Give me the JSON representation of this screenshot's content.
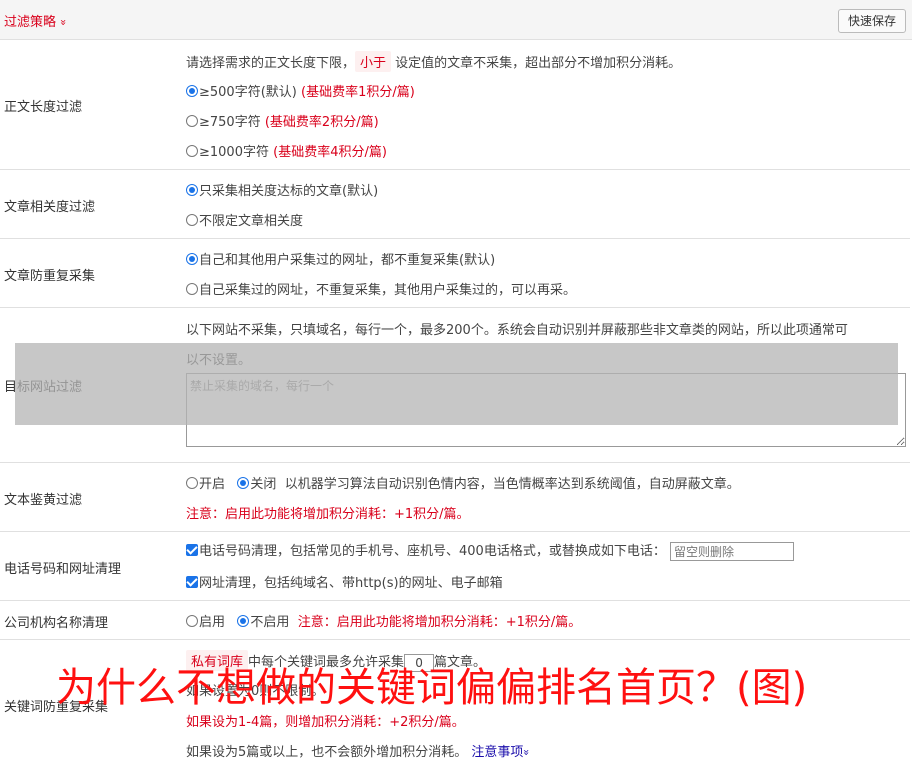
{
  "header": {
    "title": "过滤策略",
    "chevron": "»",
    "save_label": "快速保存"
  },
  "length_filter": {
    "label": "正文长度过滤",
    "desc_pre": "请选择需求的正文长度下限，",
    "desc_tag": "小于",
    "desc_post": "设定值的文章不采集，超出部分不增加积分消耗。",
    "options": [
      {
        "text": "≥500字符(默认)",
        "note": "(基础费率1积分/篇)",
        "selected": true
      },
      {
        "text": "≥750字符",
        "note": "(基础费率2积分/篇)",
        "selected": false
      },
      {
        "text": "≥1000字符",
        "note": "(基础费率4积分/篇)",
        "selected": false
      }
    ]
  },
  "relevance_filter": {
    "label": "文章相关度过滤",
    "options": [
      {
        "text": "只采集相关度达标的文章(默认)",
        "selected": true
      },
      {
        "text": "不限定文章相关度",
        "selected": false
      }
    ]
  },
  "duplicate_filter": {
    "label": "文章防重复采集",
    "options": [
      {
        "text": "自己和其他用户采集过的网址，都不重复采集(默认)",
        "selected": true
      },
      {
        "text": "自己采集过的网址，不重复采集，其他用户采集过的，可以再采。",
        "selected": false
      }
    ]
  },
  "site_filter": {
    "label": "目标网站过滤",
    "desc_line1": "以下网站不采集，只填域名，每行一个，最多200个。系统会自动识别并屏蔽那些非文章类的网站，所以此项通常可",
    "desc_line2": "以不设置。",
    "placeholder": "禁止采集的域名，每行一个"
  },
  "porn_filter": {
    "label": "文本鉴黄过滤",
    "on_label": "开启",
    "off_label": "关闭",
    "selected": "关闭",
    "desc": "以机器学习算法自动识别色情内容，当色情概率达到系统阈值，自动屏蔽文章。",
    "note": "注意：启用此功能将增加积分消耗：+1积分/篇。"
  },
  "phone_clean": {
    "label": "电话号码和网址清理",
    "phone_text": "电话号码清理，包括常见的手机号、座机号、400电话格式，或替换成如下电话：",
    "phone_checked": true,
    "phone_placeholder": "留空则删除",
    "url_text": "网址清理，包括纯域名、带http(s)的网址、电子邮箱",
    "url_checked": true
  },
  "org_clean": {
    "label": "公司机构名称清理",
    "on_label": "启用",
    "off_label": "不启用",
    "selected": "不启用",
    "note": "注意：启用此功能将增加积分消耗：+1积分/篇。"
  },
  "keyword_dedup": {
    "label": "关键词防重复采集",
    "tag": "私有词库",
    "line1_mid": "中每个关键词最多允许采集",
    "count": "0",
    "line1_post": "篇文章。",
    "line2": "如果设置为0则不限制。",
    "note": "如果设为1-4篇，则增加积分消耗：+2积分/篇。",
    "line4": "如果设为5篇或以上，也不会额外增加积分消耗。",
    "link": "注意事项",
    "link_chevron": "»"
  },
  "watermark": "为什么不想做的关键词偏偏排名首页？(图)",
  "colors": {
    "accent_red": "#d9001b",
    "radio_blue": "#1a73e8",
    "link_blue": "#1a0dab"
  }
}
